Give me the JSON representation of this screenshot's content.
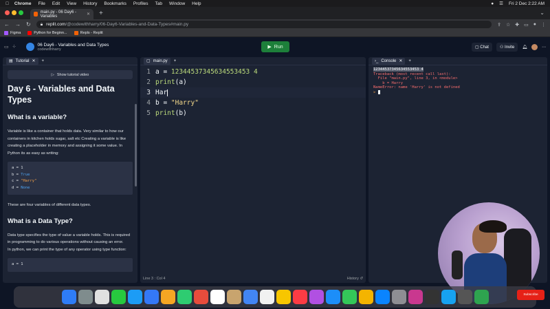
{
  "menubar": {
    "app": "Chrome",
    "items": [
      "File",
      "Edit",
      "View",
      "History",
      "Bookmarks",
      "Profiles",
      "Tab",
      "Window",
      "Help"
    ],
    "clock": "Fri 2 Dec  2:22 AM"
  },
  "browser": {
    "tab_title": "main.py - 06 Day6 - Variables",
    "url_host": "replit.com",
    "url_path": "/@codewithharry/06-Day6-Variables-and-Data-Types#main.py",
    "bookmarks": [
      {
        "label": "Figma",
        "color": "#a259ff"
      },
      {
        "label": "Python for Beginn...",
        "color": "#ff0000"
      },
      {
        "label": "Repls - Replit",
        "color": "#f26207"
      }
    ]
  },
  "repl": {
    "title": "06 Day6 - Variables and Data Types",
    "owner": "codewithharry",
    "run_label": "Run",
    "chat_label": "Chat",
    "invite_label": "Invite"
  },
  "tutorial": {
    "tab_label": "Tutorial",
    "video_button": "Show tutorial video",
    "heading": "Day 6 - Variables and Data Types",
    "h2_variable": "What is a variable?",
    "p_variable": "Variable is like a container that holds data. Very similar to how our containers in kitchen holds sugar, salt etc Creating a variable is like creating a placeholder in memory and assigning it some value. In Python its as easy as writing:",
    "code1": {
      "l1": "a = 1",
      "l2a": "b = ",
      "l2b": "True",
      "l3a": "c = ",
      "l3b": "\"Harry\"",
      "l4a": "d = ",
      "l4b": "None"
    },
    "p_four": "These are four variables of different data types.",
    "h2_datatype": "What is a Data Type?",
    "p_datatype": "Data type specifies the type of value a variable holds. This is required in programming to do various operations without causing an error.",
    "p_datatype2": "In python, we can print the type of any operator using type function:",
    "code2_l1": "a = 1"
  },
  "editor": {
    "tab_label": "main.py",
    "lines": [
      {
        "num": "1",
        "a": "a = ",
        "b": "12344537345634553453 4"
      },
      {
        "num": "2",
        "a": "print",
        "b": "(a)"
      },
      {
        "num": "3",
        "a": "Har",
        "b": ""
      },
      {
        "num": "4",
        "a": "b = ",
        "b": "\"Harry\""
      },
      {
        "num": "5",
        "a": "print",
        "b": "(b)"
      }
    ],
    "status": "Line 3 : Col 4",
    "history": "History"
  },
  "console": {
    "tab_label": "Console",
    "output_line": "12344537345634553453 4",
    "traceback": "Traceback (most recent call last):\n  File \"main.py\", line 3, in <module>\n    b = Harry\nNameError: name 'Harry' is not defined",
    "prompt": "> "
  },
  "overlay": {
    "subscribe": "Subscribe"
  },
  "dock_colors": [
    "#2e7cf6",
    "#7f8c8d",
    "#e0e0e0",
    "#27c93f",
    "#1c9cf6",
    "#3478f6",
    "#f5a623",
    "#2ecc71",
    "#e74c3c",
    "#ffffff",
    "#c8a46e",
    "#4285f4",
    "#f1f1f1",
    "#f7c600",
    "#fc3c44",
    "#b150e2",
    "#1c8ef9",
    "#34c759",
    "#f4b400",
    "#0a84ff",
    "#8e8e93",
    "#c9388f",
    "#333333",
    "#17a2f1",
    "#555555",
    "#2ea44f"
  ]
}
